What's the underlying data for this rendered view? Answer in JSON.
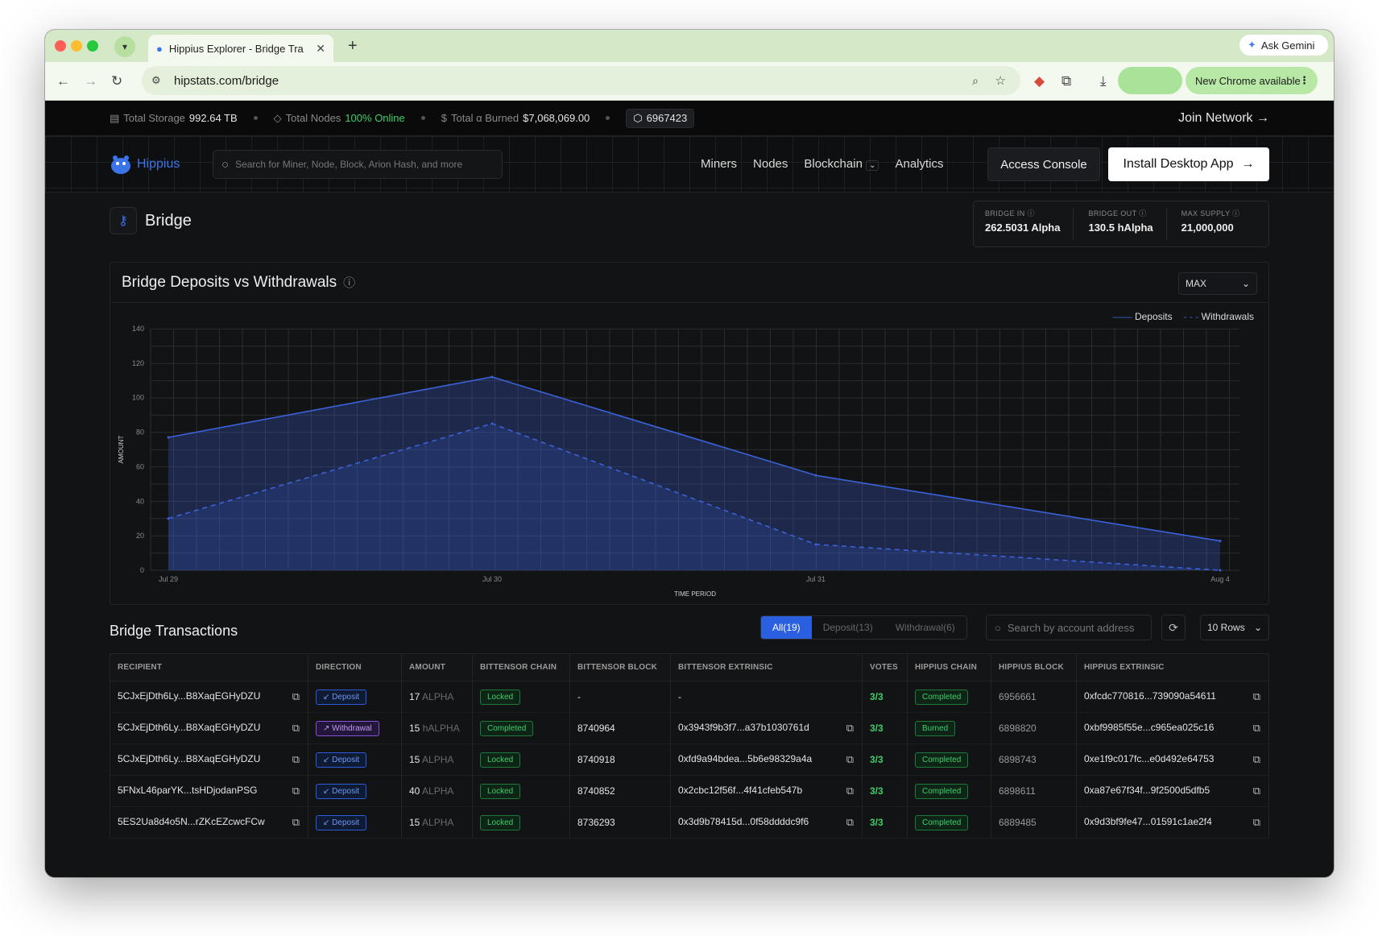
{
  "browser": {
    "tab_title": "Hippius Explorer - Bridge Tra",
    "url": "hipstats.com/bridge",
    "ask_gemini": "Ask Gemini",
    "new_chrome": "New Chrome available"
  },
  "statsbar": {
    "storage_label": "Total Storage",
    "storage_value": "992.64 TB",
    "nodes_label": "Total Nodes",
    "nodes_value": "100% Online",
    "burned_label": "Total α Burned",
    "burned_value": "$7,068,069.00",
    "block": "6967423",
    "join": "Join Network"
  },
  "nav": {
    "brand": "Hippius",
    "search_placeholder": "Search for Miner, Node, Block, Arion Hash, and more",
    "links": [
      "Miners",
      "Nodes",
      "Blockchain",
      "Analytics"
    ],
    "console": "Access Console",
    "install": "Install Desktop App"
  },
  "page": {
    "title": "Bridge",
    "stats": [
      {
        "label": "BRIDGE IN",
        "value": "262.5031 Alpha"
      },
      {
        "label": "BRIDGE OUT",
        "value": "130.5 hAlpha"
      },
      {
        "label": "MAX SUPPLY",
        "value": "21,000,000"
      }
    ]
  },
  "chart": {
    "range": "MAX"
  },
  "chart_data": {
    "type": "area",
    "title": "Bridge Deposits vs Withdrawals",
    "xlabel": "TIME PERIOD",
    "ylabel": "AMOUNT",
    "x": [
      "Jul 29",
      "Jul 30",
      "Jul 31",
      "Aug 4"
    ],
    "ylim": [
      0,
      140
    ],
    "yticks": [
      0,
      20,
      40,
      60,
      80,
      100,
      120,
      140
    ],
    "grid": true,
    "legend": "top-right",
    "series": [
      {
        "name": "Deposits",
        "values": [
          77,
          112,
          55,
          17
        ],
        "style": "solid",
        "color": "#3b62d9"
      },
      {
        "name": "Withdrawals",
        "values": [
          30,
          85,
          15,
          0
        ],
        "style": "dashed",
        "color": "#3b62d9"
      }
    ]
  },
  "transactions": {
    "title": "Bridge Transactions",
    "filters": [
      "All(19)",
      "Deposit(13)",
      "Withdrawal(6)"
    ],
    "search_placeholder": "Search by account address",
    "rows_label": "10 Rows",
    "columns": [
      "RECIPIENT",
      "DIRECTION",
      "AMOUNT",
      "BITTENSOR CHAIN",
      "BITTENSOR BLOCK",
      "BITTENSOR EXTRINSIC",
      "VOTES",
      "HIPPIUS CHAIN",
      "HIPPIUS BLOCK",
      "HIPPIUS EXTRINSIC"
    ],
    "rows": [
      {
        "recipient": "5CJxEjDth6Ly...B8XaqEGHyDZU",
        "direction": "Deposit",
        "amount": "17",
        "unit": "ALPHA",
        "bt_chain": "Locked",
        "bt_block": "-",
        "bt_extrinsic": "-",
        "votes": "3/3",
        "hp_chain": "Completed",
        "hp_block": "6956661",
        "hp_extrinsic": "0xfcdc770816...739090a54611"
      },
      {
        "recipient": "5CJxEjDth6Ly...B8XaqEGHyDZU",
        "direction": "Withdrawal",
        "amount": "15",
        "unit": "hALPHA",
        "bt_chain": "Completed",
        "bt_block": "8740964",
        "bt_extrinsic": "0x3943f9b3f7...a37b1030761d",
        "votes": "3/3",
        "hp_chain": "Burned",
        "hp_block": "6898820",
        "hp_extrinsic": "0xbf9985f55e...c965ea025c16"
      },
      {
        "recipient": "5CJxEjDth6Ly...B8XaqEGHyDZU",
        "direction": "Deposit",
        "amount": "15",
        "unit": "ALPHA",
        "bt_chain": "Locked",
        "bt_block": "8740918",
        "bt_extrinsic": "0xfd9a94bdea...5b6e98329a4a",
        "votes": "3/3",
        "hp_chain": "Completed",
        "hp_block": "6898743",
        "hp_extrinsic": "0xe1f9c017fc...e0d492e64753"
      },
      {
        "recipient": "5FNxL46parYK...tsHDjodanPSG",
        "direction": "Deposit",
        "amount": "40",
        "unit": "ALPHA",
        "bt_chain": "Locked",
        "bt_block": "8740852",
        "bt_extrinsic": "0x2cbc12f56f...4f41cfeb547b",
        "votes": "3/3",
        "hp_chain": "Completed",
        "hp_block": "6898611",
        "hp_extrinsic": "0xa87e67f34f...9f2500d5dfb5"
      },
      {
        "recipient": "5ES2Ua8d4o5N...rZKcEZcwcFCw",
        "direction": "Deposit",
        "amount": "15",
        "unit": "ALPHA",
        "bt_chain": "Locked",
        "bt_block": "8736293",
        "bt_extrinsic": "0x3d9b78415d...0f58ddddc9f6",
        "votes": "3/3",
        "hp_chain": "Completed",
        "hp_block": "6889485",
        "hp_extrinsic": "0x9d3bf9fe47...01591c1ae2f4"
      }
    ]
  }
}
